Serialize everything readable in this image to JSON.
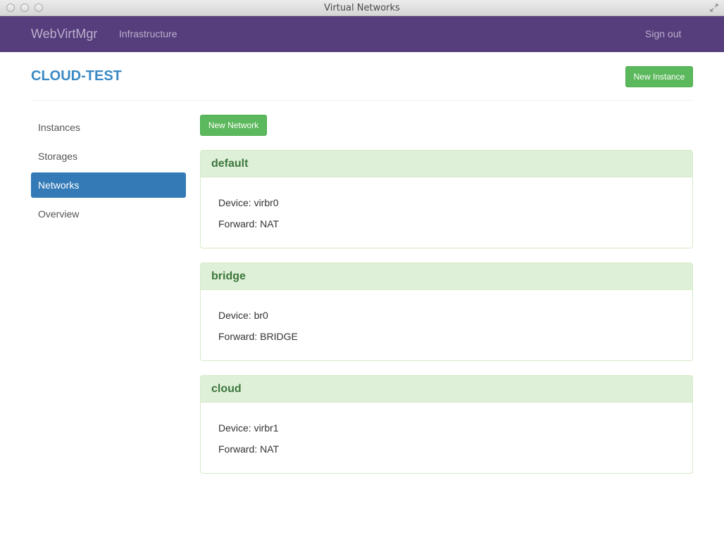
{
  "window": {
    "title": "Virtual Networks"
  },
  "navbar": {
    "brand": "WebVirtMgr",
    "links": {
      "infrastructure": "Infrastructure",
      "signout": "Sign out"
    }
  },
  "header": {
    "title": "CLOUD-TEST",
    "new_instance_label": "New Instance"
  },
  "sidebar": {
    "items": [
      {
        "label": "Instances"
      },
      {
        "label": "Storages"
      },
      {
        "label": "Networks"
      },
      {
        "label": "Overview"
      }
    ],
    "active": "Networks"
  },
  "main": {
    "new_network_label": "New Network",
    "networks": [
      {
        "name": "default",
        "device": "Device: virbr0",
        "forward": "Forward: NAT"
      },
      {
        "name": "bridge",
        "device": "Device: br0",
        "forward": "Forward: BRIDGE"
      },
      {
        "name": "cloud",
        "device": "Device: virbr1",
        "forward": "Forward: NAT"
      }
    ]
  },
  "colors": {
    "navbar": "#563d7c",
    "accent": "#337ab7",
    "success": "#5cb85c",
    "panel_heading": "#dff0d8",
    "panel_title": "#3c763d"
  },
  "icons": [
    "close-icon",
    "minimize-icon",
    "zoom-icon",
    "fullscreen-icon"
  ]
}
